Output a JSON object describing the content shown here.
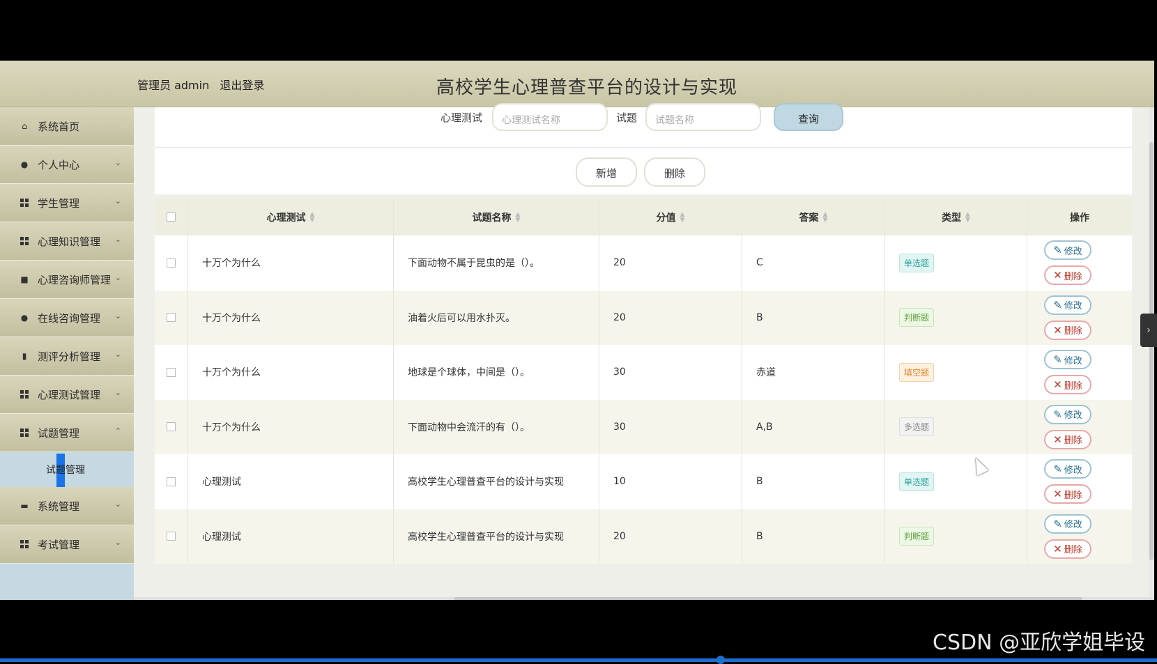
{
  "header": {
    "role_label": "管理员 admin",
    "logout_label": "退出登录",
    "site_title": "高校学生心理普查平台的设计与实现"
  },
  "sidebar": {
    "items": [
      {
        "label": "系统首页",
        "icon": "home-icon"
      },
      {
        "label": "个人中心",
        "icon": "user-icon"
      },
      {
        "label": "学生管理",
        "icon": "grid-icon"
      },
      {
        "label": "心理知识管理",
        "icon": "grid-icon"
      },
      {
        "label": "心理咨询师管理",
        "icon": "camera-icon"
      },
      {
        "label": "在线咨询管理",
        "icon": "bulb-icon"
      },
      {
        "label": "测评分析管理",
        "icon": "bar-chart-icon"
      },
      {
        "label": "心理测试管理",
        "icon": "grid-icon"
      },
      {
        "label": "试题管理",
        "icon": "grid-icon",
        "expanded": true
      },
      {
        "label": "系统管理",
        "icon": "folder-icon"
      },
      {
        "label": "考试管理",
        "icon": "grid-icon"
      }
    ],
    "submenu": {
      "label": "试题管理"
    }
  },
  "search": {
    "test_label": "心理测试",
    "test_placeholder": "心理测试名称",
    "question_label": "试题",
    "question_placeholder": "试题名称",
    "query_button": "查询"
  },
  "actions": {
    "add_label": "新增",
    "delete_label": "删除"
  },
  "table": {
    "columns": [
      "心理测试",
      "试题名称",
      "分值",
      "答案",
      "类型",
      "操作"
    ],
    "rows": [
      {
        "test": "十万个为什么",
        "question": "下面动物不属于昆虫的是（）。",
        "score": "20",
        "answer": "C",
        "type": "单选题",
        "type_kind": "single"
      },
      {
        "test": "十万个为什么",
        "question": "油着火后可以用水扑灭。",
        "score": "20",
        "answer": "B",
        "type": "判断题",
        "type_kind": "judge"
      },
      {
        "test": "十万个为什么",
        "question": "地球是个球体，中间是（）。",
        "score": "30",
        "answer": "赤道",
        "type": "填空题",
        "type_kind": "fill"
      },
      {
        "test": "十万个为什么",
        "question": "下面动物中会流汗的有（）。",
        "score": "30",
        "answer": "A,B",
        "type": "多选题",
        "type_kind": "multi"
      },
      {
        "test": "心理测试",
        "question": "高校学生心理普查平台的设计与实现",
        "score": "10",
        "answer": "B",
        "type": "单选题",
        "type_kind": "single"
      },
      {
        "test": "心理测试",
        "question": "高校学生心理普查平台的设计与实现",
        "score": "20",
        "answer": "B",
        "type": "判断题",
        "type_kind": "judge"
      }
    ],
    "edit_label": "修改",
    "delete_label": "删除"
  },
  "watermark": "CSDN @亚欣学姐毕设"
}
